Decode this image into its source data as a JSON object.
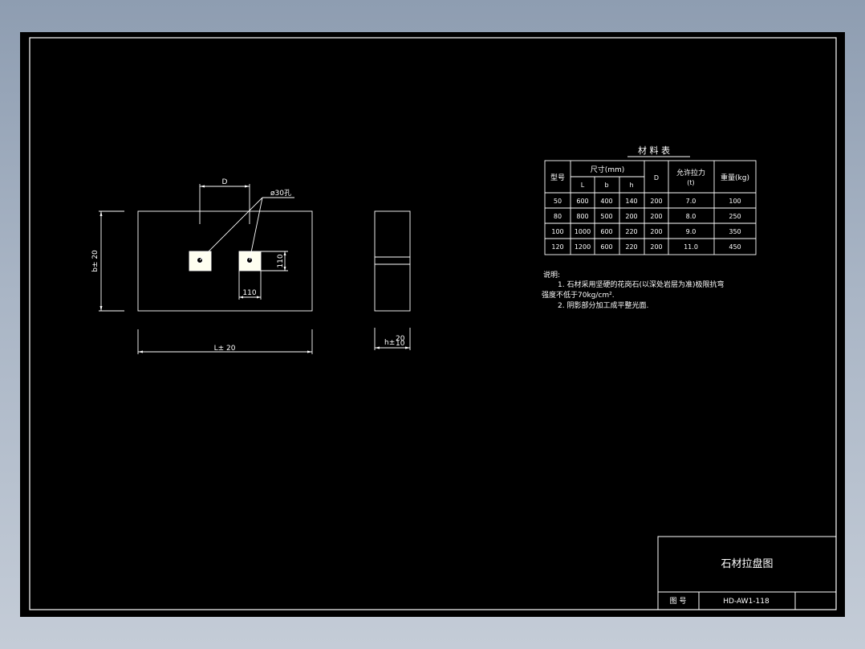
{
  "drawing": {
    "dimensions": {
      "d": "D",
      "hole": "ø30孔",
      "b": "b± 20",
      "sq_v": "110",
      "sq_h": "110",
      "l": "L± 20",
      "h": "h±",
      "h_tol_upper": "20",
      "h_tol_lower": "10"
    }
  },
  "material_table": {
    "title": "材 料 表",
    "headers": {
      "model": "型号",
      "size": "尺寸(mm)",
      "l": "L",
      "b": "b",
      "h": "h",
      "d": "D",
      "tension_line1": "允许拉力",
      "tension_line2": "(t)",
      "weight": "重量(kg)"
    },
    "rows": [
      [
        "50",
        "600",
        "400",
        "140",
        "200",
        "7.0",
        "100"
      ],
      [
        "80",
        "800",
        "500",
        "200",
        "200",
        "8.0",
        "250"
      ],
      [
        "100",
        "1000",
        "600",
        "220",
        "200",
        "9.0",
        "350"
      ],
      [
        "120",
        "1200",
        "600",
        "220",
        "200",
        "11.0",
        "450"
      ]
    ]
  },
  "notes": {
    "heading": "说明:",
    "line1": "1. 石材采用坚硬的花岗石(以深处岩层为准)极限抗弯",
    "line2": "强度不低于70kg/cm².",
    "line3": "2. 阴影部分加工成平整光面."
  },
  "title_block": {
    "title": "石材拉盘图",
    "drawing_no_label": "图   号",
    "drawing_no": "HD-AW1-118"
  },
  "colors": {
    "background": "#000000",
    "lines": "#ffffff",
    "shade": "#fffff0",
    "outer": "#9aa8ba"
  }
}
